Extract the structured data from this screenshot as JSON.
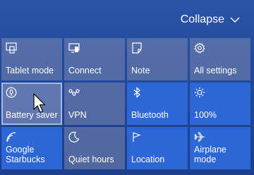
{
  "header": {
    "collapse_label": "Collapse",
    "collapse_icon": "chevron-down-icon"
  },
  "tiles": [
    {
      "label": "Tablet mode",
      "icon": "tablet-mode-icon",
      "state": "off"
    },
    {
      "label": "Connect",
      "icon": "connect-icon",
      "state": "off"
    },
    {
      "label": "Note",
      "icon": "note-icon",
      "state": "off"
    },
    {
      "label": "All settings",
      "icon": "gear-icon",
      "state": "off"
    },
    {
      "label": "Battery saver",
      "icon": "battery-saver-icon",
      "state": "hover"
    },
    {
      "label": "VPN",
      "icon": "vpn-icon",
      "state": "off"
    },
    {
      "label": "Bluetooth",
      "icon": "bluetooth-icon",
      "state": "on"
    },
    {
      "label": "100%",
      "icon": "brightness-icon",
      "state": "on"
    },
    {
      "label": "Google\nStarbucks",
      "icon": "wifi-icon",
      "state": "on"
    },
    {
      "label": "Quiet hours",
      "icon": "moon-icon",
      "state": "off"
    },
    {
      "label": "Location",
      "icon": "location-icon",
      "state": "on"
    },
    {
      "label": "Airplane mode",
      "icon": "airplane-icon",
      "state": "on"
    }
  ],
  "colors": {
    "background": "#21489a",
    "tile_on": "#2d67d6",
    "tile_off": "#7b89b0"
  }
}
